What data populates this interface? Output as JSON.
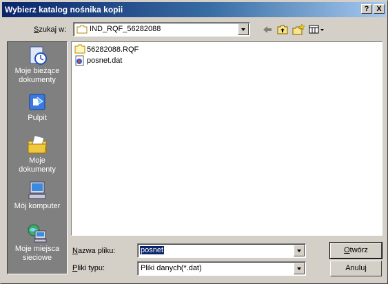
{
  "window": {
    "title": "Wybierz katalog nośnika kopii",
    "help_btn": "?",
    "close_btn": "X"
  },
  "lookin": {
    "label_u": "S",
    "label_rest": "zukaj w:",
    "value": "IND_RQF_56282088"
  },
  "toolbar": {
    "back_icon": "back-arrow-icon",
    "up_icon": "up-folder-icon",
    "new_folder_icon": "new-folder-icon",
    "view_menu_icon": "view-menu-icon"
  },
  "places": [
    {
      "label1": "Moje bieżące",
      "label2": "dokumenty",
      "icon": "recent-documents-icon"
    },
    {
      "label1": "Pulpit",
      "label2": "",
      "icon": "desktop-icon"
    },
    {
      "label1": "Moje",
      "label2": "dokumenty",
      "icon": "my-documents-icon"
    },
    {
      "label1": "Mój komputer",
      "label2": "",
      "icon": "my-computer-icon"
    },
    {
      "label1": "Moje miejsca",
      "label2": "sieciowe",
      "icon": "network-places-icon"
    }
  ],
  "files": [
    {
      "name": "56282088.RQF",
      "icon": "folder-icon"
    },
    {
      "name": "posnet.dat",
      "icon": "dat-file-icon"
    }
  ],
  "filename": {
    "label_u": "N",
    "label_rest": "azwa pliku:",
    "value": "posnet"
  },
  "filetype": {
    "label_u": "P",
    "label_rest": "liki typu:",
    "value": "Pliki danych(*.dat)"
  },
  "buttons": {
    "open_u": "O",
    "open_rest": "twórz",
    "cancel": "Anuluj"
  }
}
